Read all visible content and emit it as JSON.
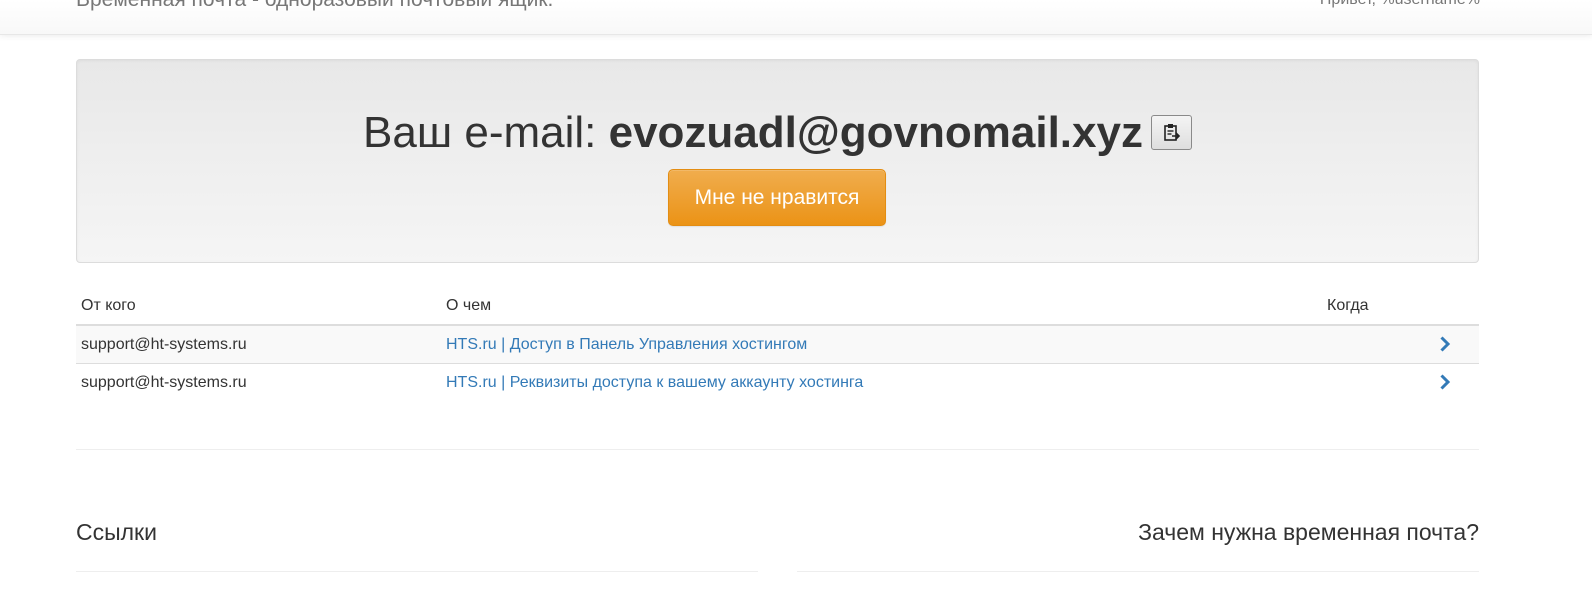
{
  "navbar": {
    "brand": "Временная почта - одноразовый почтовый ящик.",
    "greeting": "Привет, %username%"
  },
  "hero": {
    "prefix": "Ваш e-mail: ",
    "address": "evozuadl@govnomail.xyz",
    "copy_icon": "clipboard-icon",
    "dislike_label": "Мне не нравится",
    "accent_color": "#f0ad4e"
  },
  "table": {
    "headers": {
      "from": "От кого",
      "subject": "О чем",
      "when": "Когда"
    },
    "rows": [
      {
        "from": "support@ht-systems.ru",
        "subject": "HTS.ru | Доступ в Панель Управления хостингом",
        "when": ""
      },
      {
        "from": "support@ht-systems.ru",
        "subject": "HTS.ru | Реквизиты доступа к вашему аккаунту хостинга",
        "when": ""
      }
    ],
    "row_icon": "chevron-right-icon",
    "link_color": "#337ab7"
  },
  "footer": {
    "links_heading": "Ссылки",
    "why_heading": "Зачем нужна временная почта?"
  }
}
